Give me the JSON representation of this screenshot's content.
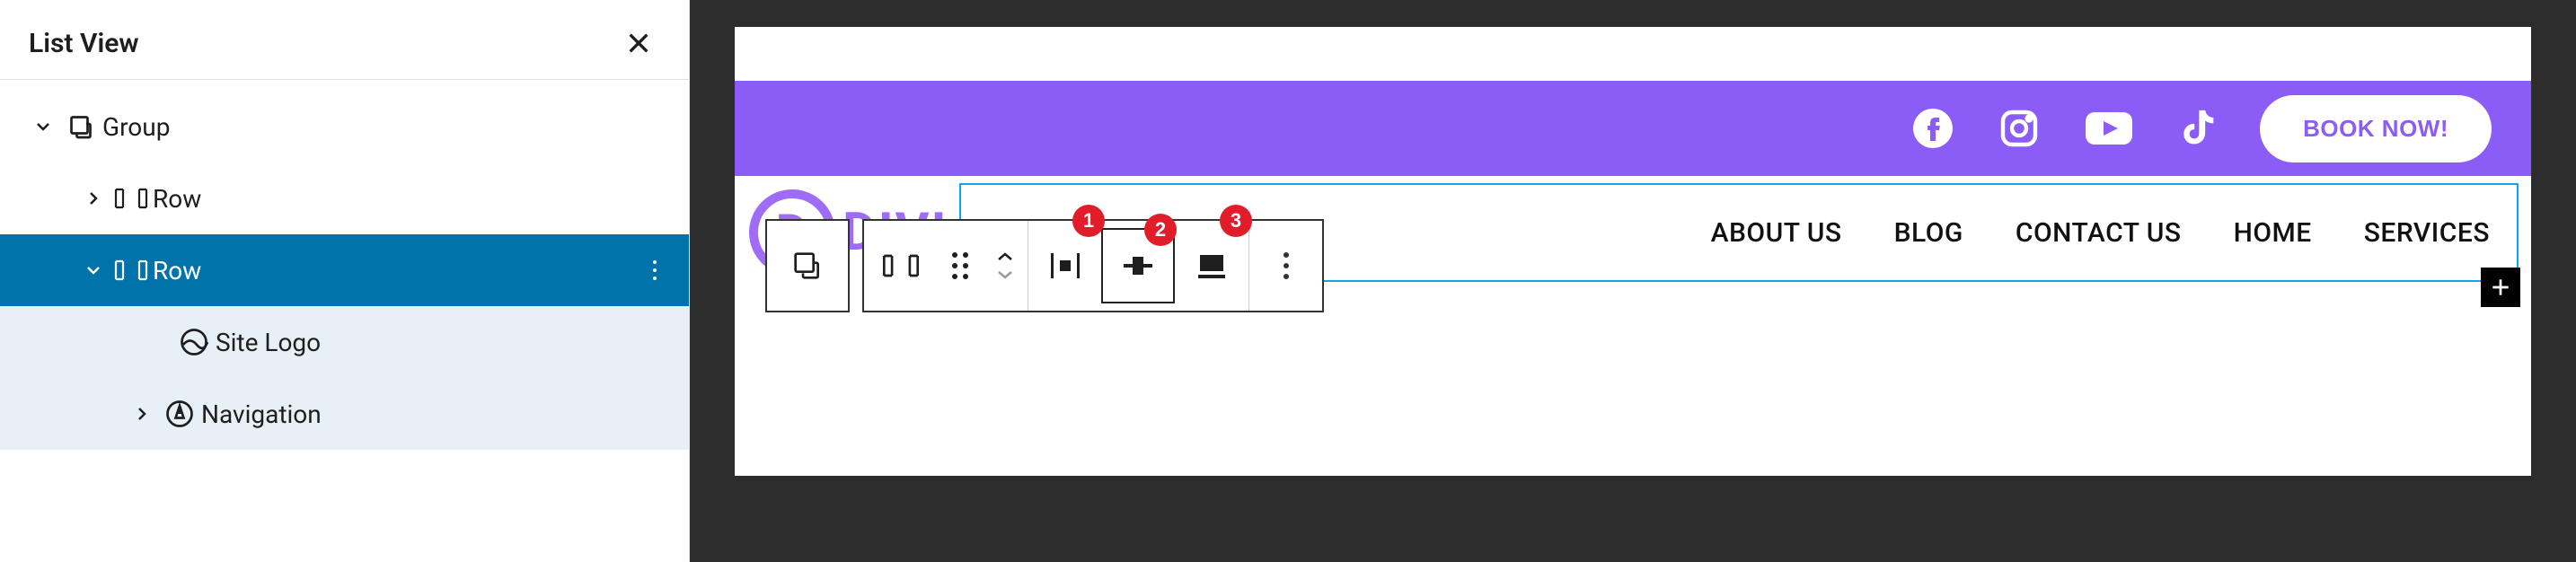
{
  "sidebar": {
    "title": "List View",
    "items": [
      {
        "label": "Group",
        "icon": "group-icon"
      },
      {
        "label": "Row",
        "icon": "row-icon"
      },
      {
        "label": "Row",
        "icon": "row-icon"
      },
      {
        "label": "Site Logo",
        "icon": "site-logo-icon"
      },
      {
        "label": "Navigation",
        "icon": "navigation-icon"
      }
    ]
  },
  "toolbar": {
    "badges": {
      "justify": "1",
      "align": "2",
      "fullwidth": "3"
    }
  },
  "topbar": {
    "cta_label": "BOOK NOW!",
    "social": [
      "facebook",
      "instagram",
      "youtube",
      "tiktok"
    ]
  },
  "nav": {
    "logo_letter": "D",
    "logo_text": "DIVI",
    "links": [
      "ABOUT US",
      "BLOG",
      "CONTACT US",
      "HOME",
      "SERVICES"
    ]
  },
  "colors": {
    "accent": "#8b5cf6",
    "selection": "#0073aa",
    "outline": "#0ea5e9",
    "badge": "#e11d2a"
  }
}
